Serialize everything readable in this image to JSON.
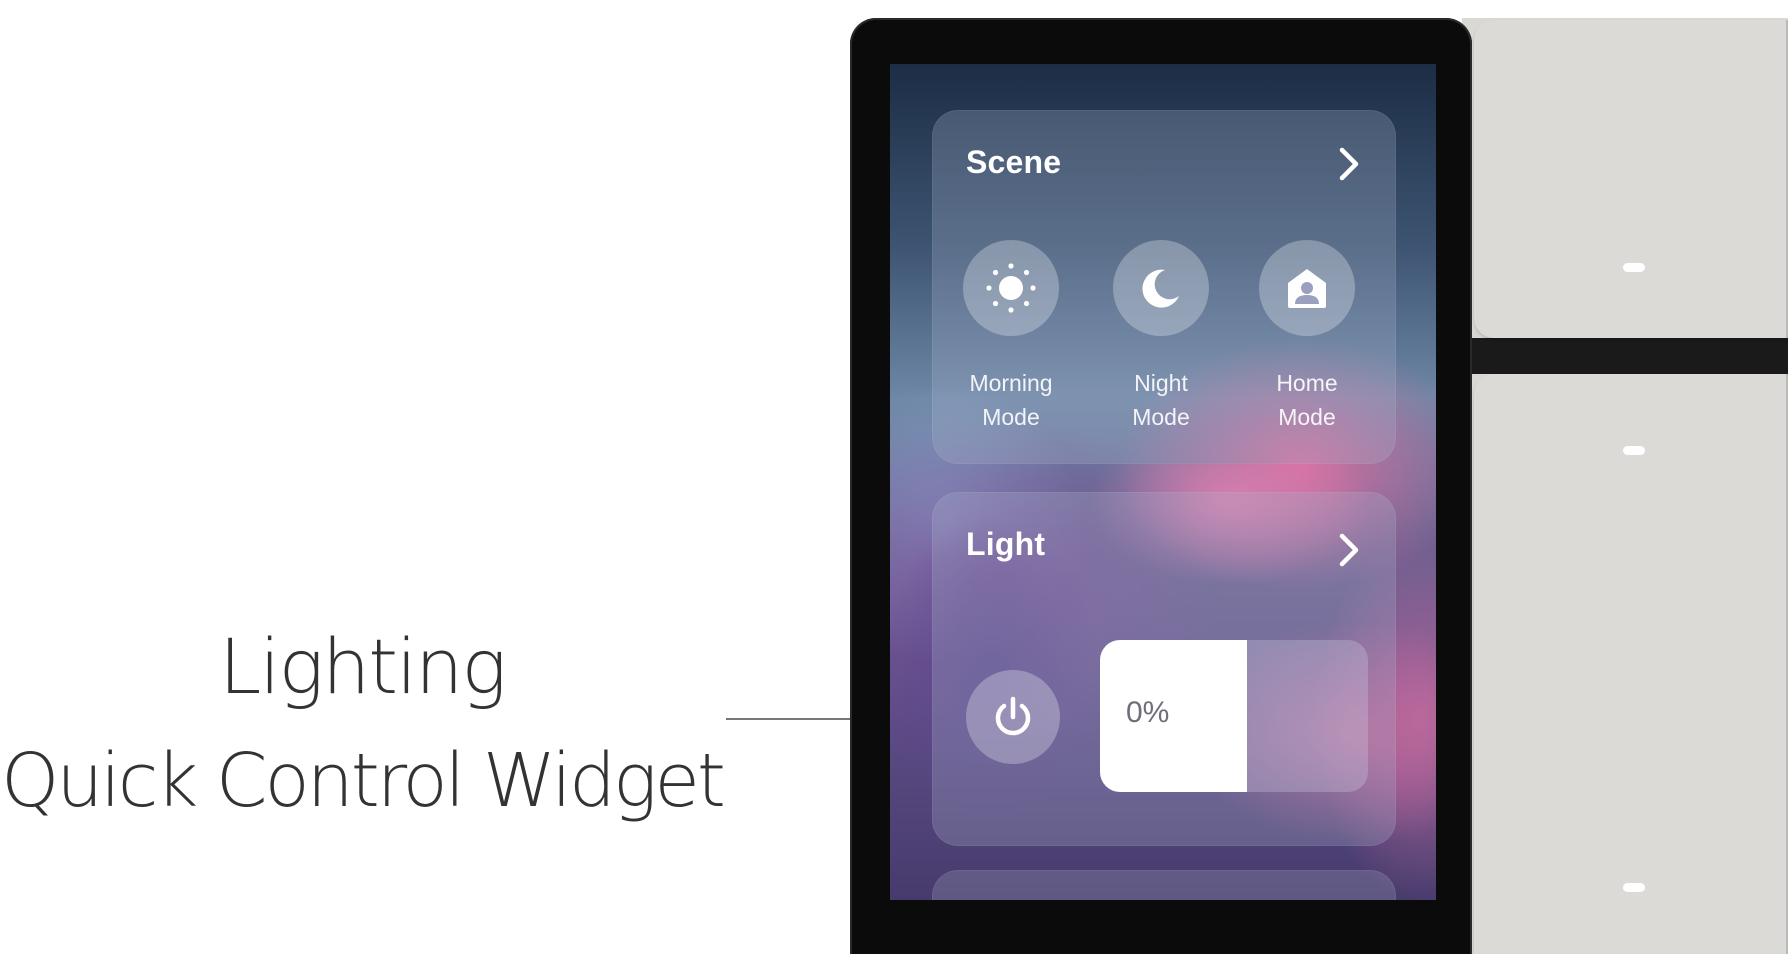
{
  "callout": {
    "line1": "Lighting",
    "line2": "Quick Control Widget"
  },
  "scene_card": {
    "title": "Scene",
    "items": [
      {
        "icon": "sun-icon",
        "label_line1": "Morning",
        "label_line2": "Mode"
      },
      {
        "icon": "moon-icon",
        "label_line1": "Night",
        "label_line2": "Mode"
      },
      {
        "icon": "home-person-icon",
        "label_line1": "Home",
        "label_line2": "Mode"
      }
    ]
  },
  "light_card": {
    "title": "Light",
    "power_icon": "power-icon",
    "brightness": {
      "value_label": "0%"
    }
  },
  "colors": {
    "card_text": "#ffffff",
    "slider_fill": "#ffffff",
    "slider_text": "#6f6f7a",
    "bezel": "#0b0b0c",
    "physical_button": "#dcdad6"
  }
}
